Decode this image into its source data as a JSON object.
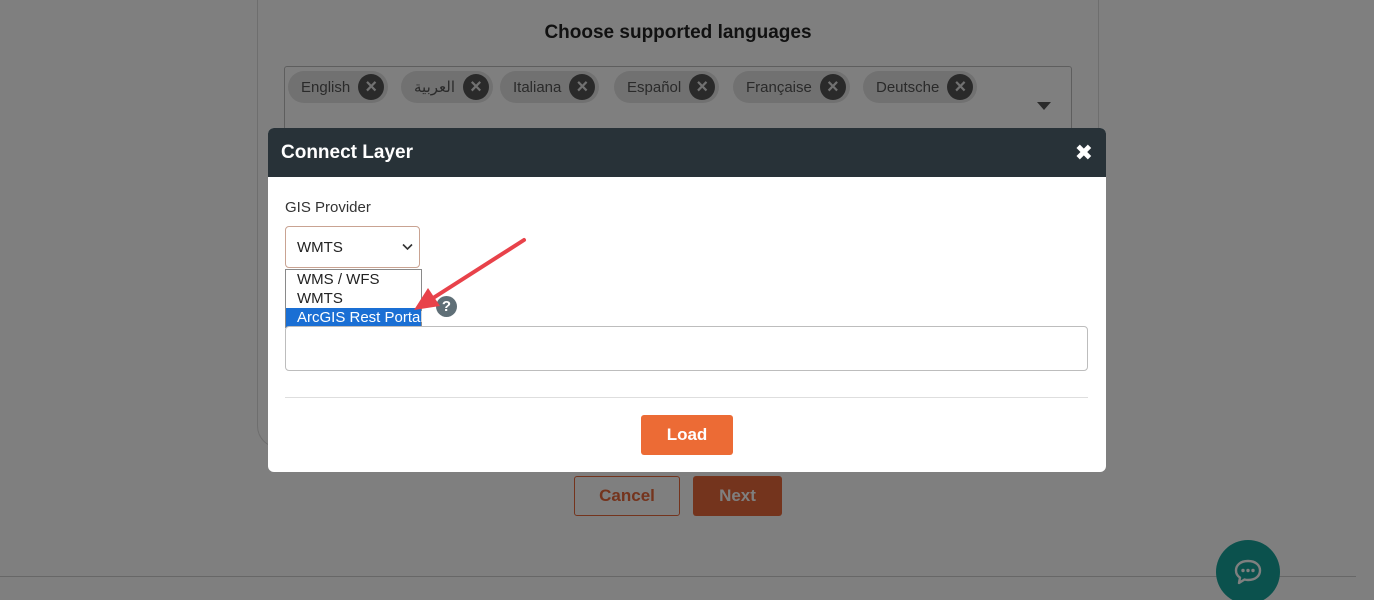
{
  "background_page": {
    "title": "Choose supported languages",
    "languages": [
      {
        "label": "English"
      },
      {
        "label": "العربية"
      },
      {
        "label": "Italiana"
      },
      {
        "label": "Español"
      },
      {
        "label": "Française"
      },
      {
        "label": "Deutsche"
      }
    ],
    "remove_glyph": "×",
    "cancel_label": "Cancel",
    "next_label": "Next"
  },
  "modal": {
    "title": "Connect Layer",
    "close_glyph": "✖",
    "gis_provider_label": "GIS Provider",
    "selected_value": "WMTS",
    "chevron_glyph": "⌄",
    "options": [
      {
        "label": "WMS / WFS",
        "highlighted": false
      },
      {
        "label": "WMTS",
        "highlighted": false
      },
      {
        "label": "ArcGIS Rest Portal",
        "highlighted": true
      }
    ],
    "help_glyph": "?",
    "url_value": "",
    "load_label": "Load"
  },
  "colors": {
    "accent": "#ec6b35",
    "header_bg": "#283238",
    "highlight": "#1a6fd4",
    "chat_fab": "#17a39a",
    "annotation_arrow": "#e8424a"
  },
  "icons": {
    "chip_remove": "close-circle-icon",
    "modal_close": "close-icon",
    "help": "question-circle-icon",
    "chat": "chat-bubble-icon",
    "annotation": "red-arrow-annotation"
  }
}
